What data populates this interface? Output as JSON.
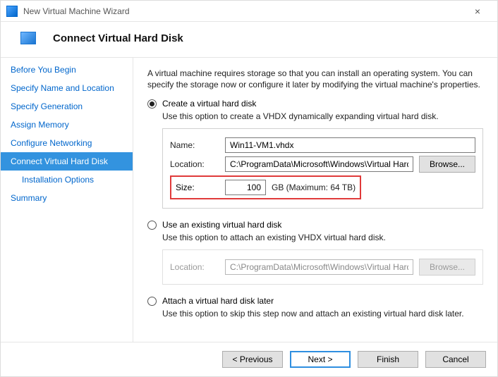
{
  "titlebar": {
    "title": "New Virtual Machine Wizard"
  },
  "header": {
    "title": "Connect Virtual Hard Disk"
  },
  "sidebar": {
    "steps": [
      {
        "label": "Before You Begin"
      },
      {
        "label": "Specify Name and Location"
      },
      {
        "label": "Specify Generation"
      },
      {
        "label": "Assign Memory"
      },
      {
        "label": "Configure Networking"
      },
      {
        "label": "Connect Virtual Hard Disk",
        "selected": true
      },
      {
        "label": "Installation Options",
        "sub": true
      },
      {
        "label": "Summary"
      }
    ]
  },
  "content": {
    "intro": "A virtual machine requires storage so that you can install an operating system. You can specify the storage now or configure it later by modifying the virtual machine's properties.",
    "opt1": {
      "label": "Create a virtual hard disk",
      "desc": "Use this option to create a VHDX dynamically expanding virtual hard disk.",
      "name_label": "Name:",
      "name_value": "Win11-VM1.vhdx",
      "location_label": "Location:",
      "location_value": "C:\\ProgramData\\Microsoft\\Windows\\Virtual Hard Disks\\",
      "browse": "Browse...",
      "size_label": "Size:",
      "size_value": "100",
      "size_suffix": "GB (Maximum: 64 TB)"
    },
    "opt2": {
      "label": "Use an existing virtual hard disk",
      "desc": "Use this option to attach an existing VHDX virtual hard disk.",
      "location_label": "Location:",
      "location_value": "C:\\ProgramData\\Microsoft\\Windows\\Virtual Hard Disks\\",
      "browse": "Browse..."
    },
    "opt3": {
      "label": "Attach a virtual hard disk later",
      "desc": "Use this option to skip this step now and attach an existing virtual hard disk later."
    }
  },
  "footer": {
    "previous": "< Previous",
    "next": "Next >",
    "finish": "Finish",
    "cancel": "Cancel"
  }
}
